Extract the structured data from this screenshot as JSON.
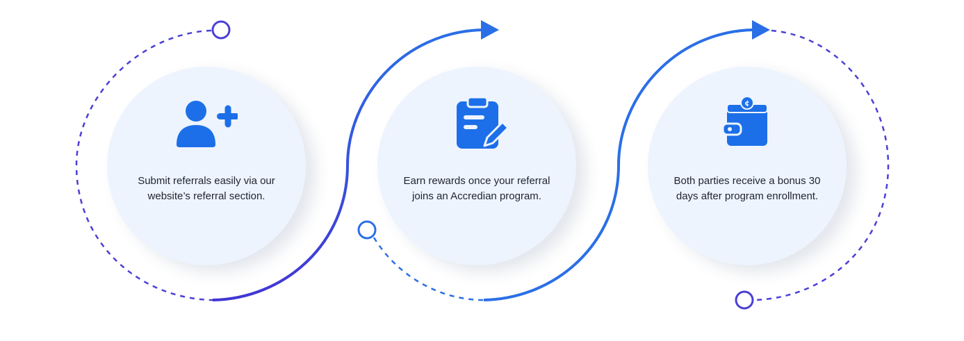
{
  "colors": {
    "violet": "#4a3fd6",
    "blue": "#2b6fe6",
    "icon_blue": "#1c6fe8",
    "circle_bg": "#edf4fe",
    "text": "#1f2430"
  },
  "steps": [
    {
      "icon": "add-user-icon",
      "text": "Submit referrals easily via our website’s referral section."
    },
    {
      "icon": "clipboard-edit-icon",
      "text": "Earn rewards once your referral joins an Accredian program."
    },
    {
      "icon": "wallet-icon",
      "text": "Both parties receive a bonus 30 days after program enrollment."
    }
  ]
}
